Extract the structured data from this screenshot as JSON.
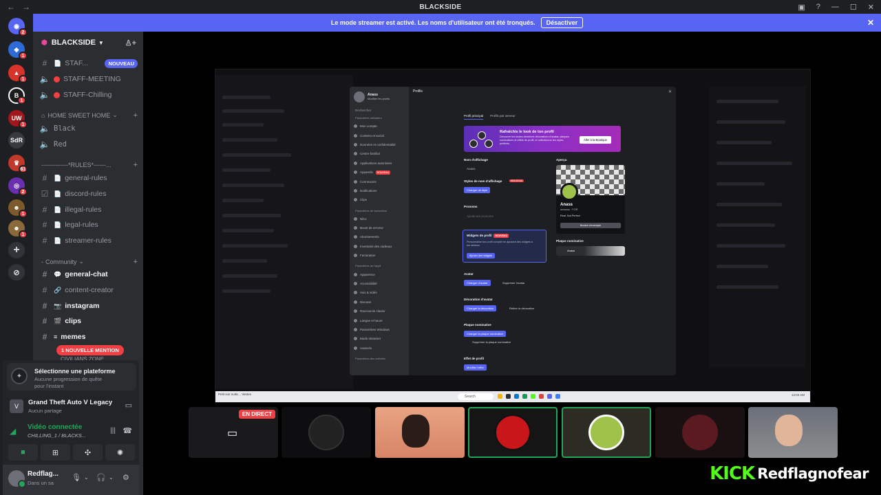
{
  "window": {
    "title": "BLACKSIDE",
    "back": "←",
    "forward": "→"
  },
  "banner": {
    "text": "Le mode streamer est activé. Les noms d'utilisateur ont été tronqués.",
    "button": "Désactiver"
  },
  "rail": {
    "servers": [
      {
        "label": "",
        "badge": "2",
        "color": "#5865f2"
      },
      {
        "label": "",
        "badge": "1",
        "color": "#2f6bd6"
      },
      {
        "label": "",
        "badge": "1",
        "color": "#d9342b"
      },
      {
        "label": "",
        "badge": "1",
        "color": "#1b1b1b"
      },
      {
        "label": "",
        "badge": "1",
        "color": "#a0161a"
      },
      {
        "label": "SdR",
        "badge": "",
        "color": "#36393f"
      },
      {
        "label": "",
        "badge": "61",
        "color": "#c0392b"
      },
      {
        "label": "",
        "badge": "2",
        "color": "#6a2fb0"
      },
      {
        "label": "",
        "badge": "1",
        "color": "#7d5a2c"
      },
      {
        "label": "",
        "badge": "1",
        "color": "#8a6a3a"
      }
    ]
  },
  "sidebar": {
    "server_name": "BLACKSIDE",
    "channels_top": [
      {
        "name": "STAF...",
        "badge": "NOUVEAU"
      },
      {
        "name": "STAFF-MEETING"
      },
      {
        "name": "STAFF-Chilling"
      }
    ],
    "cat_home": "HOME SWEET HOME",
    "home_channels": [
      "Black",
      "Red"
    ],
    "cat_rules": "-------------*RULES*------...",
    "rules_channels": [
      "general-rules",
      "discord-rules",
      "illegal-rules",
      "legal-rules",
      "streamer-rules"
    ],
    "cat_community": "Community",
    "community_channels": [
      "general-chat",
      "content-creator",
      "instagram",
      "clips",
      "memes"
    ],
    "mention": "1 NOUVELLE MENTION",
    "cut_category": "CIVILIANS ZONE"
  },
  "panel": {
    "platform_title": "Sélectionne une plateforme",
    "platform_desc": "Aucune progression de quête pour l'instant",
    "game_title": "Grand Theft Auto V Legacy",
    "game_sub": "Aucun partage",
    "video_title": "Vidéo connectée",
    "video_sub": "CHILLING_1 / BLACKS...",
    "user_name": "Redflag...",
    "user_status": "Dans un sa"
  },
  "settings": {
    "profile_name": "Anass",
    "profile_edit": "Modifier les profils",
    "search": "Rechercher",
    "section_user": "Paramètres utilisateur",
    "nav_user": [
      "Mon compte",
      "Contenu et social",
      "Données et confidentialité",
      "Centre familial",
      "Applications autorisées",
      "Appareils",
      "Connexions",
      "Notifications",
      "Clips"
    ],
    "new_badge": "NOUVEAU",
    "section_billing": "Paramètres de facturation",
    "nav_billing": [
      "Nitro",
      "Boost de serveur",
      "Abonnements",
      "Inventaire des cadeaux",
      "Facturation"
    ],
    "section_app": "Paramètres de l'appli",
    "nav_app": [
      "Apparence",
      "Accessibilité",
      "Voix & vidéo",
      "Discuter",
      "Raccourcis clavier",
      "Langue et heure",
      "Paramètres Windows",
      "Mode streamer",
      "Avancés"
    ],
    "section_activity": "Paramètres des activités",
    "title": "Profils",
    "tab_main": "Profil principal",
    "tab_server": "Profils par serveur",
    "promo_title": "Rafraîchis le look de ton profil",
    "promo_desc": "Découvre les toutes dernières décorations d'avatar, plaques nominatives et effets de profil, et collectionne tes styles préférés.",
    "promo_button": "Aller à la Boutique",
    "display_name_label": "Nom d'affichage",
    "display_name_value": "Anass",
    "name_style_label": "Styles de nom d'affichage",
    "name_style_button": "Changer de style",
    "pronouns_label": "Pronoms",
    "pronouns_placeholder": "Ajoute tes pronoms",
    "widgets_title": "Widgets de profil",
    "widgets_desc": "Personnalise ton profil complet en ajoutant des widgets à ton tableau",
    "widgets_button": "Ajouter des widgets",
    "avatar_label": "Avatar",
    "avatar_change": "Changer d'avatar",
    "avatar_remove": "Supprimer l'avatar",
    "deco_label": "Décoration d'avatar",
    "deco_change": "Changer la décoration",
    "deco_remove": "Retirer la décoration",
    "plate_label": "Plaque nominative",
    "plate_change": "Changer la plaque nominative",
    "plate_remove": "Supprimer la plaque nominative",
    "effect_label": "Effet de profil",
    "effect_button": "Modifier l'effet",
    "preview_label": "Aperçu",
    "preview_name": "Anass",
    "preview_sub": "anassss · FOR",
    "preview_bio": "Real, Not Perfect",
    "preview_button": "Bouton d'exemple",
    "plate_preview_label": "Plaque nominative",
    "plate_preview_name": "Anass",
    "taskbar_left": "Petit soir nuitic... Ventes",
    "taskbar_search": "Search",
    "taskbar_right": "12:02 AM"
  },
  "participants": {
    "live_label": "EN DIRECT"
  },
  "kick": {
    "logo": "KICK",
    "name": "Redflagnofear"
  }
}
